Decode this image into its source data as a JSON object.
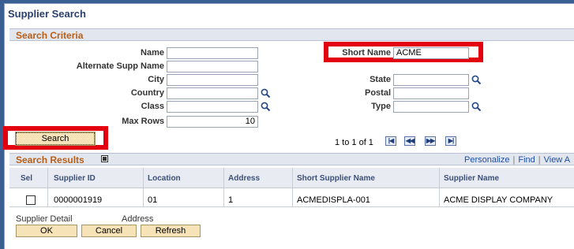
{
  "page": {
    "title": "Supplier Search"
  },
  "criteria": {
    "header": "Search Criteria",
    "fields": {
      "name": {
        "label": "Name",
        "value": ""
      },
      "alt_name": {
        "label": "Alternate Supp Name",
        "value": ""
      },
      "city": {
        "label": "City",
        "value": ""
      },
      "country": {
        "label": "Country",
        "value": ""
      },
      "class": {
        "label": "Class",
        "value": ""
      },
      "max_rows": {
        "label": "Max Rows",
        "value": "10"
      },
      "short_name": {
        "label": "Short Name",
        "value": "ACME"
      },
      "state": {
        "label": "State",
        "value": ""
      },
      "postal": {
        "label": "Postal",
        "value": ""
      },
      "type": {
        "label": "Type",
        "value": ""
      }
    },
    "search_button": "Search"
  },
  "pager": {
    "text": "1 to 1 of 1",
    "first": "|◀",
    "prev": "◀◀",
    "next": "▶▶",
    "last": "▶|"
  },
  "results": {
    "header": "Search Results",
    "links": {
      "personalize": "Personalize",
      "find": "Find",
      "view_all": "View A"
    },
    "columns": [
      "Sel",
      "Supplier ID",
      "Location",
      "Address",
      "Short Supplier Name",
      "Supplier Name"
    ],
    "rows": [
      {
        "selected": false,
        "supplier_id": "0000001919",
        "location": "01",
        "address": "1",
        "short_name": "ACMEDISPLA-001",
        "supplier_name": "ACME DISPLAY COMPANY"
      }
    ]
  },
  "footer": {
    "supplier_detail": "Supplier Detail",
    "address": "Address",
    "ok": "OK",
    "cancel": "Cancel",
    "refresh": "Refresh"
  },
  "colors": {
    "highlight": "#e3000f",
    "section_text": "#b85e16",
    "title": "#2a3f6b",
    "link": "#1f4fa8"
  },
  "icons": {
    "lookup": "magnifier-icon",
    "grid_zoom": "zoom-icon"
  }
}
